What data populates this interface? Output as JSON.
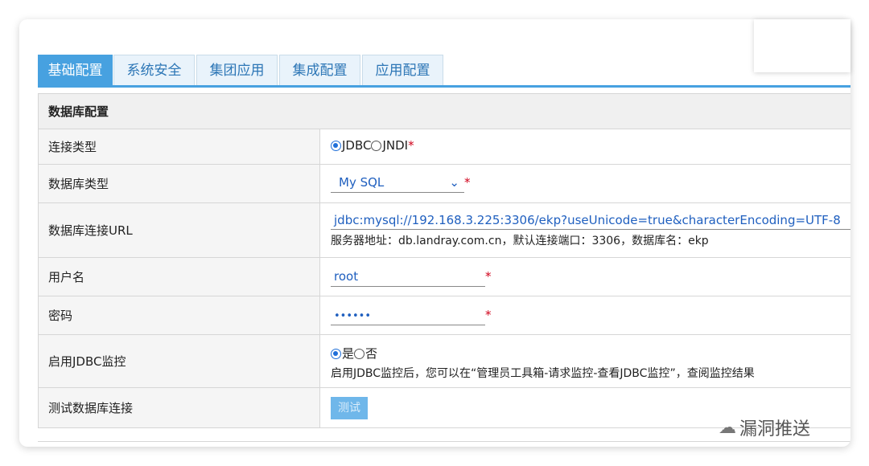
{
  "tabs": [
    {
      "label": "基础配置",
      "active": true
    },
    {
      "label": "系统安全",
      "active": false
    },
    {
      "label": "集团应用",
      "active": false
    },
    {
      "label": "集成配置",
      "active": false
    },
    {
      "label": "应用配置",
      "active": false
    }
  ],
  "section_title": "数据库配置",
  "rows": {
    "conn_type": {
      "label": "连接类型",
      "option1": "JDBC",
      "option2": "JNDI",
      "required": "*"
    },
    "db_type": {
      "label": "数据库类型",
      "value": "My SQL",
      "required": "*"
    },
    "db_url": {
      "label": "数据库连接URL",
      "value": "jdbc:mysql://192.168.3.225:3306/ekp?useUnicode=true&characterEncoding=UTF-8",
      "hint": "服务器地址：db.landray.com.cn，默认连接端口：3306，数据库名：ekp"
    },
    "username": {
      "label": "用户名",
      "value": "root",
      "required": "*"
    },
    "password": {
      "label": "密码",
      "value": "••••••",
      "required": "*"
    },
    "jdbc_monitor": {
      "label": "启用JDBC监控",
      "option1": "是",
      "option2": "否",
      "hint": "启用JDBC监控后，您可以在“管理员工具箱-请求监控-查看JDBC监控”，查阅监控结果"
    },
    "test_conn": {
      "label": "测试数据库连接",
      "button": "测试"
    }
  },
  "watermark": "漏洞推送",
  "colors": {
    "accent": "#47a1e0",
    "link": "#1f5fbf",
    "required": "#d0021b"
  }
}
